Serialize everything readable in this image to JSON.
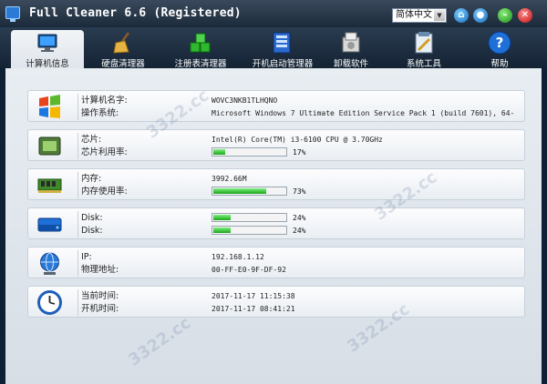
{
  "window": {
    "title": "Full Cleaner 6.6 (Registered)",
    "language": "简体中文"
  },
  "tabs": [
    {
      "label": "计算机信息",
      "icon": "monitor-icon",
      "active": true
    },
    {
      "label": "硬盘清理器",
      "icon": "broom-icon",
      "active": false
    },
    {
      "label": "注册表清理器",
      "icon": "registry-cubes-icon",
      "active": false
    },
    {
      "label": "开机启动管理器",
      "icon": "startup-manager-icon",
      "active": false
    },
    {
      "label": "卸载软件",
      "icon": "uninstall-box-icon",
      "active": false
    },
    {
      "label": "系统工具",
      "icon": "system-tools-icon",
      "active": false
    },
    {
      "label": "帮助",
      "icon": "help-icon",
      "active": false
    }
  ],
  "computer": {
    "name_label": "计算机名字:",
    "name_value": "WOVC3NKB1TLHQNO",
    "os_label": "操作系统:",
    "os_value": "Microsoft Windows 7 Ultimate Edition Service Pack 1 (build 7601), 64-"
  },
  "cpu": {
    "label": "芯片:",
    "value": "Intel(R) Core(TM) i3-6100 CPU @ 3.70GHz",
    "usage_label": "芯片利用率:",
    "usage_text": "17%",
    "usage_fraction": 0.17
  },
  "memory": {
    "label": "内存:",
    "value": "3992.66M",
    "usage_label": "内存使用率:",
    "usage_text": "73%",
    "usage_fraction": 0.73
  },
  "disks": [
    {
      "label": "Disk:",
      "usage_text": "24%",
      "usage_fraction": 0.24
    },
    {
      "label": "Disk:",
      "usage_text": "24%",
      "usage_fraction": 0.24
    }
  ],
  "network": {
    "ip_label": "IP:",
    "ip_value": "192.168.1.12",
    "mac_label": "物理地址:",
    "mac_value": "00-FF-E0-9F-DF-92"
  },
  "time": {
    "current_label": "当前时间:",
    "current_value": "2017-11-17   11:15:38",
    "boot_label": "开机时间:",
    "boot_value": "2017-11-17   08:41:21"
  },
  "watermark": "3322.cc",
  "colors": {
    "progress_fill": "#1aa51a",
    "close_button": "#c21212",
    "minimize_button": "#1c8a1a"
  }
}
